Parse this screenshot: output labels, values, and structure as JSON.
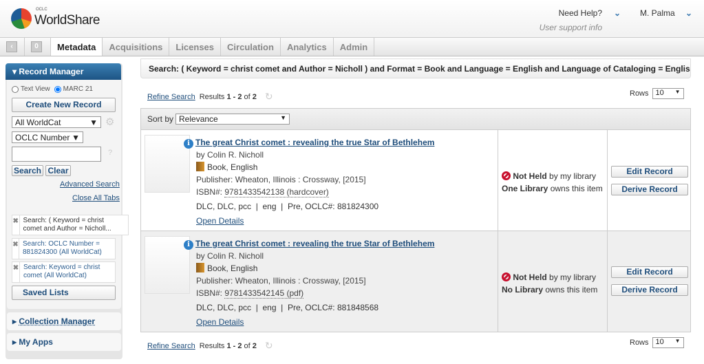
{
  "header": {
    "logo_small": "OCLC",
    "logo_text": "WorldShare",
    "help": "Need Help?",
    "help_sub": "User support info",
    "user": "M. Palma"
  },
  "nav": {
    "counter": "0",
    "tabs": [
      "Metadata",
      "Acquisitions",
      "Licenses",
      "Circulation",
      "Analytics",
      "Admin"
    ],
    "active": "Metadata"
  },
  "sidebar": {
    "title": "Record Manager",
    "view_options": [
      "Text View",
      "MARC 21"
    ],
    "selected_view": "MARC 21",
    "create": "Create New Record",
    "scope": "All WorldCat",
    "index": "OCLC Number",
    "search_value": "",
    "search": "Search",
    "clear": "Clear",
    "advanced": "Advanced Search",
    "close_tabs": "Close All Tabs",
    "history": [
      "Search: ( Keyword = christ comet and Author = Nicholl...",
      "Search: OCLC Number = 881824300 (All WorldCat)",
      "Search: Keyword = christ comet (All WorldCat)"
    ],
    "saved_lists": "Saved Lists",
    "collection_manager": "Collection Manager",
    "my_apps": "My Apps"
  },
  "search": {
    "query": "Search: ( Keyword = christ comet and Author = Nicholl ) and Format = Book and Language = English and Language of Cataloging = English (All W...",
    "refine": "Refine Search",
    "results_label": "Results",
    "results_range": "1 - 2",
    "results_of": "of",
    "results_total": "2",
    "rows_label": "Rows",
    "rows_value": "10",
    "sort_label": "Sort by",
    "sort_value": "Relevance"
  },
  "results": [
    {
      "title": "The great Christ comet : revealing the true Star of Bethlehem",
      "author": "by Colin R. Nicholl",
      "format": "Book, English",
      "publisher": "Publisher: Wheaton, Illinois : Crossway, [2015]",
      "isbn_label": "ISBN#:",
      "isbn": "9781433542138 (hardcover)",
      "meta": "DLC, DLC, pcc  |  eng  |  Pre, OCLC#: 881824300",
      "open": "Open Details",
      "held": "Not Held",
      "held_rest": " by my library",
      "owners": "One Library",
      "owners_rest": " owns this item",
      "edit": "Edit Record",
      "derive": "Derive Record"
    },
    {
      "title": "The great Christ comet : revealing the true Star of Bethlehem",
      "author": "by Colin R. Nicholl",
      "format": "Book, English",
      "publisher": "Publisher: Wheaton, Illinois : Crossway, [2015]",
      "isbn_label": "ISBN#:",
      "isbn": "9781433542145 (pdf)",
      "meta": "DLC, DLC, pcc  |  eng  |  Pre, OCLC#: 881848568",
      "open": "Open Details",
      "held": "Not Held",
      "held_rest": " by my library",
      "owners": "No Library",
      "owners_rest": " owns this item",
      "edit": "Edit Record",
      "derive": "Derive Record"
    }
  ]
}
